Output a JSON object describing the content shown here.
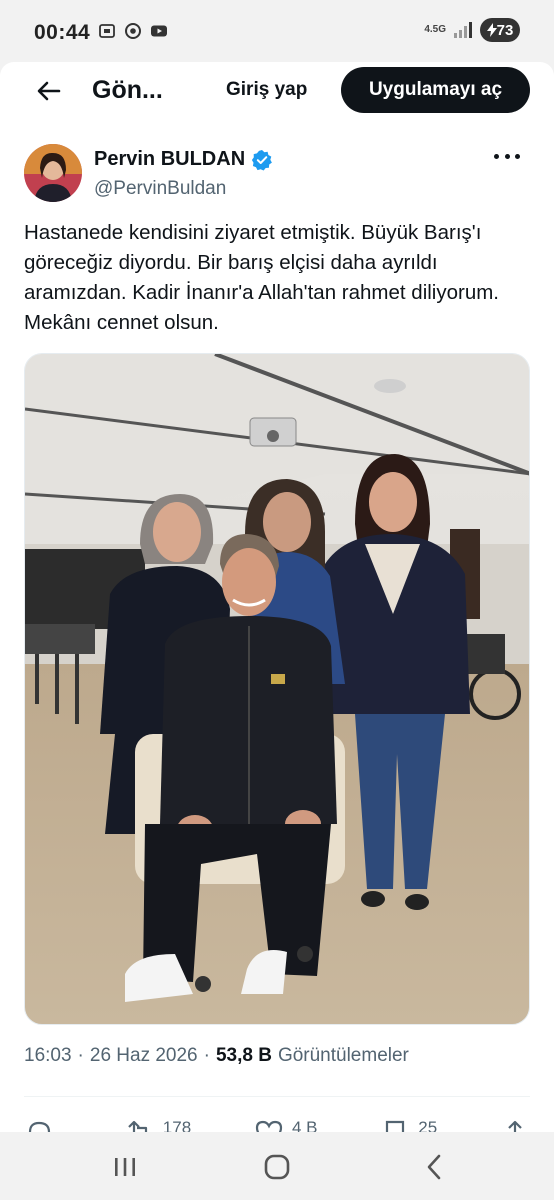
{
  "status_bar": {
    "time": "00:44",
    "network_label": "4.5G",
    "battery_percent": "73",
    "icons": [
      "screenshot-icon",
      "chrome-icon",
      "youtube-icon",
      "signal-icon",
      "battery-charging-icon"
    ]
  },
  "header": {
    "title": "Gön...",
    "login_label": "Giriş yap",
    "open_app_label": "Uygulamayı aç",
    "back_icon": "arrow-left-icon"
  },
  "author": {
    "name": "Pervin BULDAN",
    "handle": "@PervinBuldan",
    "verified": true
  },
  "tweet": {
    "text": "Hastanede kendisini ziyaret etmiştik. Büyük Barış'ı göreceğiz diyordu. Bir barış elçisi daha ayrıldı aramızdan. Kadir İnanır'a Allah'tan rahmet diliyorum. Mekânı cennet olsun."
  },
  "meta": {
    "time": "16:03",
    "date": "26 Haz 2026",
    "views_count": "53,8 B",
    "views_label": "Görüntülemeler",
    "separator": "·"
  },
  "actions": {
    "reply_count": "",
    "retweet_count": "178",
    "like_count": "4 B",
    "bookmark_count": "25"
  },
  "colors": {
    "primary_text": "#0f1419",
    "secondary_text": "#536471",
    "verified_blue": "#1d9bf0",
    "button_dark": "#0f1419"
  }
}
